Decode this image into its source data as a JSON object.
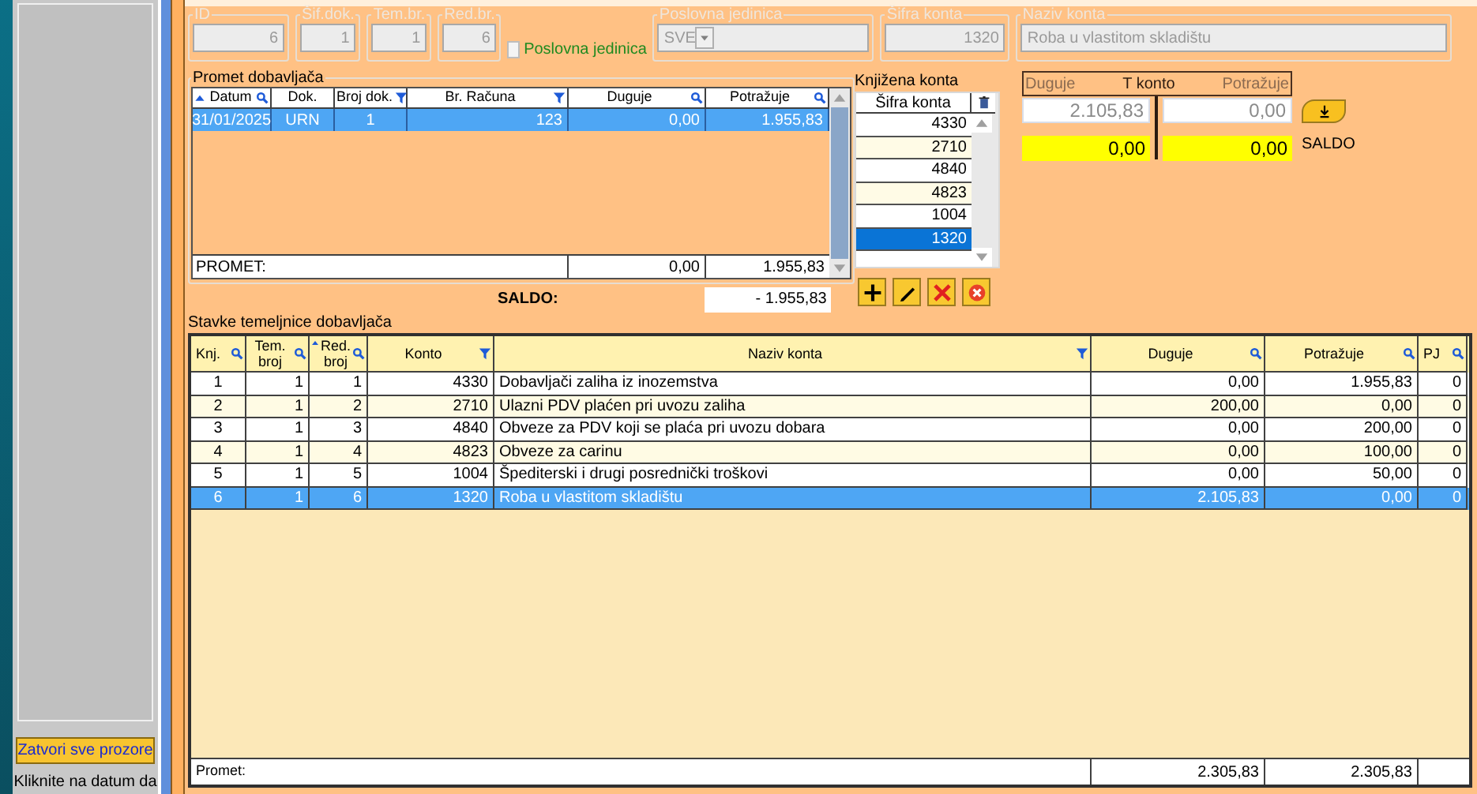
{
  "left_panel": {
    "close_all_button": "Zatvori sve prozore",
    "hint": "Kliknite na datum da"
  },
  "fields": [
    {
      "kind": "text",
      "label": "ID",
      "value": "6",
      "disabled": true
    },
    {
      "kind": "text",
      "label": "Šif.dok.",
      "value": "1",
      "disabled": true
    },
    {
      "kind": "text",
      "label": "Tem.br.",
      "value": "1",
      "disabled": true
    },
    {
      "kind": "text",
      "label": "Red.br.",
      "value": "6",
      "disabled": true
    },
    {
      "kind": "checkbox",
      "label": "Poslovna jedinica",
      "checked": false
    },
    {
      "kind": "combo",
      "label": "Poslovna jedinica",
      "value": "SVE",
      "disabled": true
    },
    {
      "kind": "text",
      "label": "Šifra konta",
      "value": "1320",
      "disabled": true
    },
    {
      "kind": "wide",
      "label": "Naziv konta",
      "value": "Roba u vlastitom skladištu",
      "disabled": true
    }
  ],
  "promet": {
    "title": "Promet dobavljača",
    "columns": [
      {
        "label": "Datum",
        "sorted": true
      },
      {
        "label": "Dok.",
        "sorted": false
      },
      {
        "label": "Broj dok.",
        "sorted": false
      },
      {
        "label": "Br. Računa",
        "sorted": false
      },
      {
        "label": "Duguje",
        "sorted": false
      },
      {
        "label": "Potražuje",
        "sorted": false
      }
    ],
    "rows": [
      {
        "cells": [
          "31/01/2025",
          "URN",
          "1",
          "123",
          "0,00",
          "1.955,83"
        ],
        "selected": true
      }
    ],
    "footer": {
      "label": "PROMET:",
      "duguje": "0,00",
      "potrazuje": "1.955,83"
    },
    "saldo": {
      "label": "SALDO:",
      "value": "- 1.955,83"
    }
  },
  "konta": {
    "title": "Knjižena konta",
    "column": "Šifra konta",
    "items": [
      {
        "code": "4330",
        "selected": false
      },
      {
        "code": "2710",
        "selected": false
      },
      {
        "code": "4840",
        "selected": false
      },
      {
        "code": "4823",
        "selected": false
      },
      {
        "code": "1004",
        "selected": false
      },
      {
        "code": "1320",
        "selected": true
      }
    ]
  },
  "t_konto": {
    "debit_label": "Duguje",
    "title": "T konto",
    "credit_label": "Potražuje",
    "debit": "2.105,83",
    "credit": "0,00",
    "saldo_debit": "0,00",
    "saldo_credit": "0,00",
    "saldo_label": "SALDO"
  },
  "stavke": {
    "title": "Stavke temeljnice dobavljača",
    "columns": [
      {
        "label": "Knj.",
        "sorted": false
      },
      {
        "label": "Tem. broj",
        "sorted": false
      },
      {
        "label": "Red. broj",
        "sorted": true
      },
      {
        "label": "Konto",
        "sorted": false
      },
      {
        "label": "Naziv konta",
        "sorted": false
      },
      {
        "label": "Duguje",
        "sorted": false
      },
      {
        "label": "Potražuje",
        "sorted": false
      },
      {
        "label": "PJ",
        "sorted": false
      }
    ],
    "rows": [
      {
        "cells": [
          "1",
          "1",
          "1",
          "4330",
          "Dobavljači zaliha iz inozemstva",
          "0,00",
          "1.955,83",
          "0"
        ],
        "selected": false
      },
      {
        "cells": [
          "2",
          "1",
          "2",
          "2710",
          "Ulazni PDV plaćen pri uvozu zaliha",
          "200,00",
          "0,00",
          "0"
        ],
        "selected": false
      },
      {
        "cells": [
          "3",
          "1",
          "3",
          "4840",
          "Obveze za PDV koji se plaća pri uvozu dobara",
          "0,00",
          "200,00",
          "0"
        ],
        "selected": false
      },
      {
        "cells": [
          "4",
          "1",
          "4",
          "4823",
          "Obveze za carinu",
          "0,00",
          "100,00",
          "0"
        ],
        "selected": false
      },
      {
        "cells": [
          "5",
          "1",
          "5",
          "1004",
          "Špediterski i drugi posrednički troškovi",
          "0,00",
          "50,00",
          "0"
        ],
        "selected": false
      },
      {
        "cells": [
          "6",
          "1",
          "6",
          "1320",
          "Roba u vlastitom skladištu",
          "2.105,83",
          "0,00",
          "0"
        ],
        "selected": true
      }
    ],
    "footer": {
      "label": "Promet:",
      "duguje": "2.305,83",
      "potrazuje": "2.305,83"
    }
  }
}
